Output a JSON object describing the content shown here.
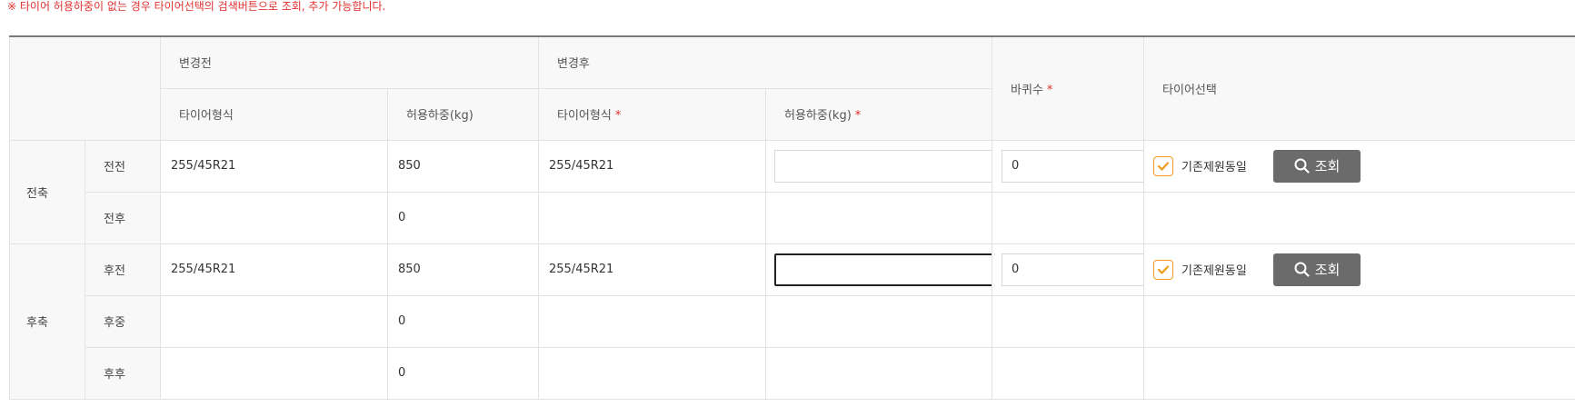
{
  "notice": "※ 타이어 허용하중이 없는 경우 타이어선택의 검색버튼으로 조회, 추가 가능합니다.",
  "header": {
    "before": "변경전",
    "after": "변경후",
    "wheel_count": "바퀴수",
    "tire_select": "타이어선택",
    "tire_type": "타이어형식",
    "load": "허용하중(kg)",
    "tire_type_after": "타이어형식",
    "load_after": "허용하중(kg)",
    "required_mark": "*"
  },
  "axles": {
    "front": "전축",
    "rear": "후축"
  },
  "rows": [
    {
      "pos": "전전",
      "before_type": "255/45R21",
      "before_load": "850",
      "after_type": "255/45R21",
      "after_load": "",
      "wheels": "0",
      "same_label": "기존제원동일",
      "search": "조회"
    },
    {
      "pos": "전후",
      "before_type": "",
      "before_load": "0"
    },
    {
      "pos": "후전",
      "before_type": "255/45R21",
      "before_load": "850",
      "after_type": "255/45R21",
      "after_load": "",
      "wheels": "0",
      "same_label": "기존제원동일",
      "search": "조회"
    },
    {
      "pos": "후중",
      "before_type": "",
      "before_load": "0"
    },
    {
      "pos": "후후",
      "before_type": "",
      "before_load": "0"
    }
  ],
  "colors": {
    "accent": "#f29a1c",
    "required": "#e03030",
    "button": "#6b6b6b"
  },
  "icons": {
    "check": "check-icon",
    "search": "search-icon"
  }
}
